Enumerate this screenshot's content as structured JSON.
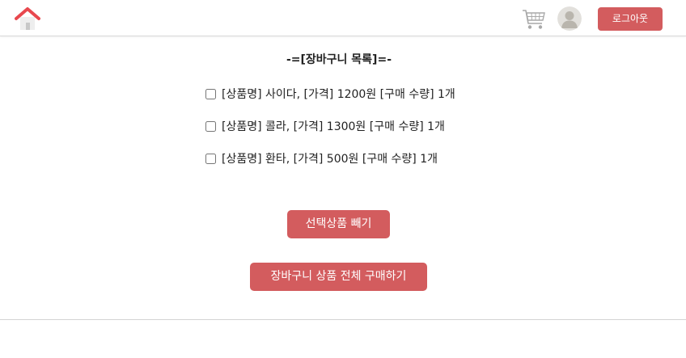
{
  "colors": {
    "accent": "#d35c5e",
    "home_roof": "#e8484e",
    "avatar_bg": "#e2e0dc",
    "avatar_fg": "#b9b5ad"
  },
  "header": {
    "home_icon": "house-icon",
    "cart_icon": "shopping-cart-icon",
    "avatar_icon": "user-avatar-icon",
    "logout_label": "로그아웃"
  },
  "cart": {
    "title": "-=[장바구니 목록]=-",
    "items": [
      {
        "text": "[상품명] 사이다, [가격] 1200원 [구매 수량] 1개",
        "checked": false
      },
      {
        "text": "[상품명] 콜라, [가격] 1300원 [구매 수량] 1개",
        "checked": false
      },
      {
        "text": "[상품명] 환타, [가격] 500원 [구매 수량] 1개",
        "checked": false
      }
    ],
    "remove_label": "선택상품 빼기",
    "buy_all_label": "장바구니 상품 전체 구매하기"
  }
}
